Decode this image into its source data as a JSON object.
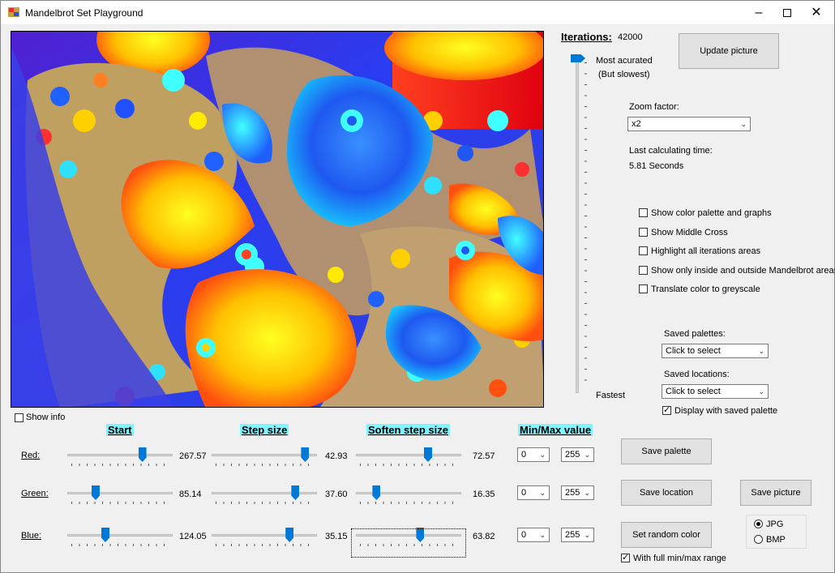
{
  "window": {
    "title": "Mandelbrot Set Playground"
  },
  "iterations": {
    "label": "Iterations:",
    "value": "42000",
    "top_label": "Most acurated",
    "top_sub": "(But slowest)",
    "bottom_label": "Fastest",
    "position": 0.0
  },
  "buttons": {
    "update": "Update picture",
    "save_palette": "Save  palette",
    "save_location": "Save location",
    "save_picture": "Save picture",
    "random_color": "Set random color"
  },
  "zoom": {
    "label": "Zoom factor:",
    "value": "x2"
  },
  "calc": {
    "label": "Last calculating time:",
    "value": "5.81 Seconds"
  },
  "options": [
    {
      "label": "Show color palette and graphs",
      "checked": false
    },
    {
      "label": "Show Middle Cross",
      "checked": false
    },
    {
      "label": "Highlight all iterations areas",
      "checked": false
    },
    {
      "label": "Show only inside and outside Mandelbrot areas",
      "checked": false
    },
    {
      "label": "Translate color to greyscale",
      "checked": false
    }
  ],
  "saved": {
    "palettes_label": "Saved palettes:",
    "palettes_value": "Click to select",
    "locations_label": "Saved locations:",
    "locations_value": "Click to select",
    "display_label": "Display with saved palette",
    "display_checked": true
  },
  "show_info": {
    "label": "Show info",
    "checked": false
  },
  "headers": {
    "start": "Start",
    "step": "Step size",
    "soften": "Soften step size",
    "minmax": "Min/Max value"
  },
  "rows": [
    {
      "label": "Red:",
      "start": "267.57",
      "step": "42.93",
      "soften": "72.57",
      "min": "0",
      "max": "255",
      "start_pos": 0.73,
      "step_pos": 0.92,
      "soften_pos": 0.7
    },
    {
      "label": "Green:",
      "start": "85.14",
      "step": "37.60",
      "soften": "16.35",
      "min": "0",
      "max": "255",
      "start_pos": 0.25,
      "step_pos": 0.82,
      "soften_pos": 0.17
    },
    {
      "label": "Blue:",
      "start": "124.05",
      "step": "35.15",
      "soften": "63.82",
      "min": "0",
      "max": "255",
      "start_pos": 0.35,
      "step_pos": 0.76,
      "soften_pos": 0.62
    }
  ],
  "format": {
    "jpg": "JPG",
    "bmp": "BMP",
    "selected": "JPG"
  },
  "full_range": {
    "label": "With full min/max range",
    "checked": true
  },
  "colors": {
    "slider": "#0078d7",
    "header_bg": "#7ff5ff"
  }
}
